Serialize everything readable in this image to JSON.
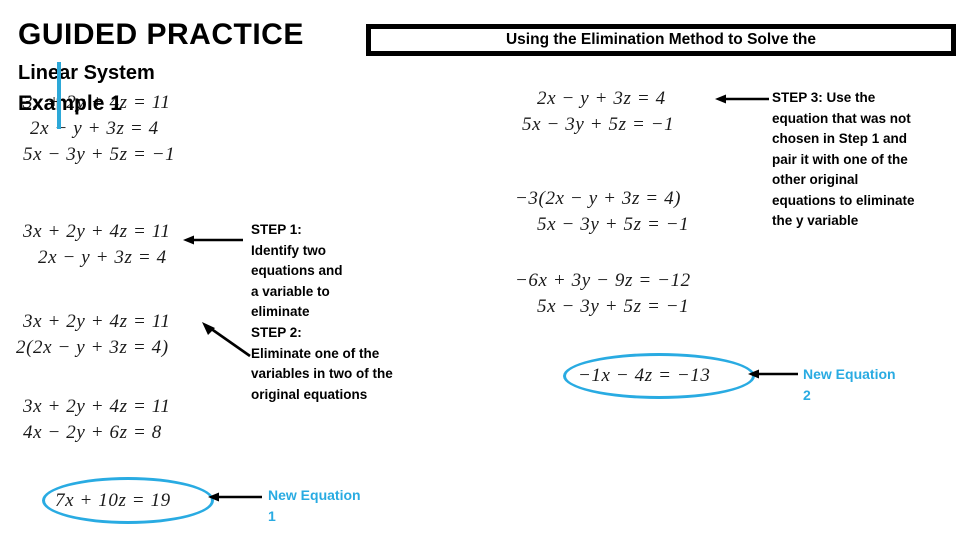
{
  "slide": {
    "heading_main": "GUIDED PRACTICE",
    "heading_sub": "Linear System",
    "heading_example": "Example 1",
    "title_box": "Using the Elimination Method to Solve the"
  },
  "colors": {
    "accent_cyan": "#29ABE2",
    "caret_cyan": "#2ca8d8",
    "text_black": "#000000",
    "math_ink": "#1a1a1a"
  },
  "left_column": {
    "system": {
      "line1": "3x + 2y + 4z = 11",
      "line2": "2x − y + 3z = 4",
      "line3": "5x − 3y + 5z = −1"
    },
    "step1_pair": {
      "line1": "3x + 2y + 4z = 11",
      "line2": "2x − y + 3z = 4"
    },
    "step2_multiply": {
      "line1": "3x + 2y + 4z = 11",
      "line2": "2(2x − y + 3z = 4)"
    },
    "step2_result": {
      "line1": "3x + 2y + 4z = 11",
      "line2": "4x − 2y + 6z = 8"
    },
    "new_equation_1": {
      "equation": "7x + 10z = 19",
      "label_line1": "New Equation",
      "label_line2": "1"
    }
  },
  "center_steps": {
    "step1_heading": "STEP 1:",
    "step1_body": "Identify two equations and a variable to eliminate",
    "step2_heading": "STEP 2:",
    "step2_body": "Eliminate one of the variables in two of the original equations"
  },
  "right_column": {
    "step3_pair": {
      "line1": "2x − y + 3z = 4",
      "line2": "5x − 3y + 5z = −1"
    },
    "step3_multiply": {
      "line1": "−3(2x − y + 3z = 4)",
      "line2": "5x − 3y + 5z = −1"
    },
    "step3_result": {
      "line1": "−6x + 3y − 9z = −12",
      "line2": "5x − 3y + 5z = −1"
    },
    "new_equation_2": {
      "equation": "−1x − 4z = −13",
      "label_line1": "New Equation",
      "label_line2": "2"
    },
    "step3_text": "STEP 3: Use the equation that was not chosen in Step 1 and pair it with one of the other original equations to eliminate the y variable"
  }
}
